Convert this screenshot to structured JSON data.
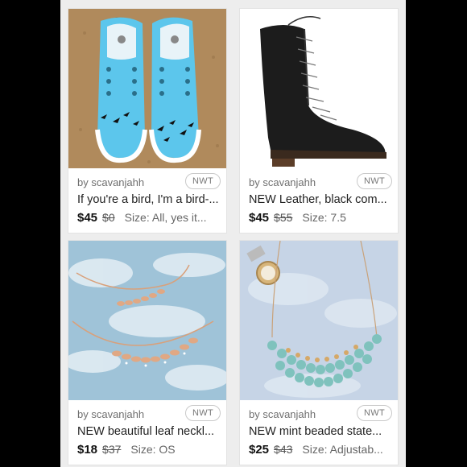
{
  "listings": [
    {
      "seller": "by scavanjahh",
      "badge": "NWT",
      "title": "If you're a bird, I'm a bird-...",
      "price": "$45",
      "original_price": "$0",
      "size": "Size: All, yes it...",
      "image": "blue-painted-sneakers"
    },
    {
      "seller": "by scavanjahh",
      "badge": "NWT",
      "title": "NEW Leather, black com...",
      "price": "$45",
      "original_price": "$55",
      "size": "Size: 7.5",
      "image": "black-combat-boot"
    },
    {
      "seller": "by scavanjahh",
      "badge": "NWT",
      "title": "NEW beautiful leaf neckl...",
      "price": "$18",
      "original_price": "$37",
      "size": "Size: OS",
      "image": "rose-gold-leaf-necklace"
    },
    {
      "seller": "by scavanjahh",
      "badge": "NWT",
      "title": "NEW mint beaded state...",
      "price": "$25",
      "original_price": "$43",
      "size": "Size: Adjustab...",
      "image": "mint-beaded-statement-necklace"
    }
  ]
}
